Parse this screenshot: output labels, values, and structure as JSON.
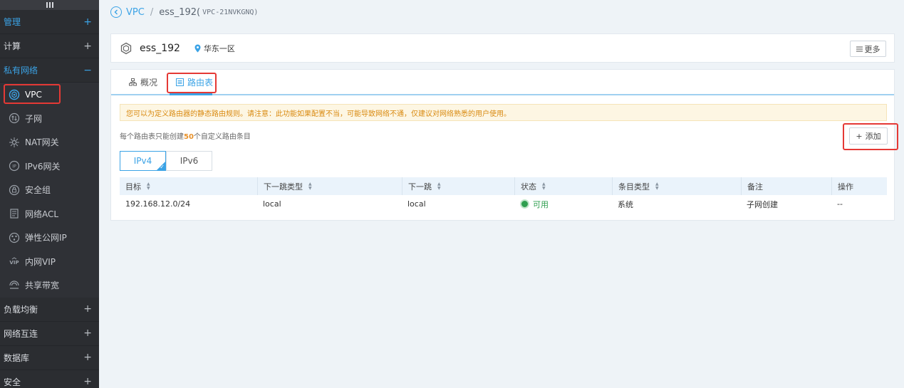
{
  "sidebar": {
    "groups_top": [
      {
        "label": "管理",
        "sign": "+"
      },
      {
        "label": "计算",
        "sign": "+"
      },
      {
        "label": "私有网络",
        "sign": "−"
      }
    ],
    "items": [
      {
        "label": "VPC",
        "icon": "vpc-icon"
      },
      {
        "label": "子网",
        "icon": "subnet-icon"
      },
      {
        "label": "NAT网关",
        "icon": "nat-gateway-icon"
      },
      {
        "label": "IPv6网关",
        "icon": "ipv6-gateway-icon"
      },
      {
        "label": "安全组",
        "icon": "security-group-icon"
      },
      {
        "label": "网络ACL",
        "icon": "network-acl-icon"
      },
      {
        "label": "弹性公网IP",
        "icon": "elastic-ip-icon"
      },
      {
        "label": "内网VIP",
        "icon": "vip-icon"
      },
      {
        "label": "共享带宽",
        "icon": "shared-bandwidth-icon"
      }
    ],
    "groups_bottom": [
      {
        "label": "负载均衡",
        "sign": "+"
      },
      {
        "label": "网络互连",
        "sign": "+"
      },
      {
        "label": "数据库",
        "sign": "+"
      },
      {
        "label": "安全",
        "sign": "+"
      }
    ]
  },
  "breadcrumb": {
    "root": "VPC",
    "separator": "/",
    "current": "ess_192(",
    "id": "VPC-21NVKGNQ)"
  },
  "header": {
    "name": "ess_192",
    "region": "华东一区",
    "more_label": "更多"
  },
  "tabs": [
    {
      "label": "概况",
      "icon": "overview-icon"
    },
    {
      "label": "路由表",
      "icon": "route-table-icon"
    }
  ],
  "notice": "您可以为定义路由器的静态路由规则。请注意：此功能如果配置不当，可能导致网络不通，仅建议对网络熟悉的用户使用。",
  "limit": {
    "prefix": "每个路由表只能创建",
    "count": "50",
    "suffix": "个自定义路由条目"
  },
  "add_label": "添加",
  "ip_versions": [
    "IPv4",
    "IPv6"
  ],
  "table": {
    "columns": [
      "目标",
      "下一跳类型",
      "下一跳",
      "状态",
      "条目类型",
      "备注",
      "操作"
    ],
    "rows": [
      {
        "target": "192.168.12.0/24",
        "nexthop_type": "local",
        "nexthop": "local",
        "status": "可用",
        "entry_type": "系统",
        "remark": "子网创建",
        "action": "--"
      }
    ]
  },
  "colors": {
    "accent": "#3ba3e6",
    "highlight": "#e53935",
    "status_ok": "#2e9e4f",
    "sidebar_bg": "#2b2d31"
  }
}
